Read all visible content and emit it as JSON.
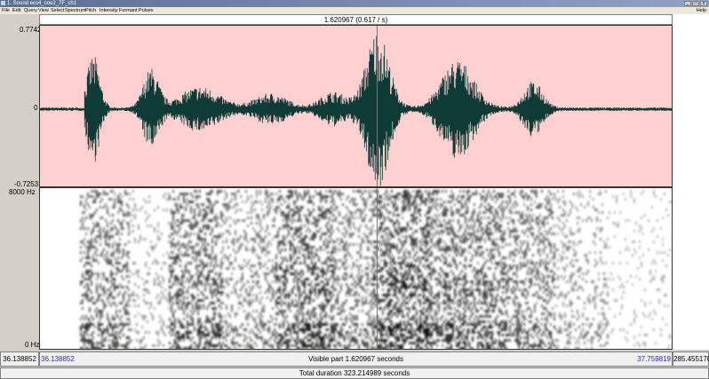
{
  "window": {
    "title": "1. Sound ecs4_coe2_7F_ch1"
  },
  "menu": {
    "items": [
      "File",
      "Edit",
      "Query",
      "View",
      "Select",
      "Spectrum",
      "Pitch",
      "Intensity",
      "Formant",
      "Pulses"
    ],
    "help": "Help"
  },
  "header": {
    "selection_label": "1.620967 (0.617 / s)"
  },
  "waveform": {
    "ymax": "0.7742",
    "zero": "0",
    "ymin": "-0.7253"
  },
  "spectrogram": {
    "fmax": "8000 Hz",
    "fmin": "0 Hz"
  },
  "footer": {
    "left_time": "36.138852",
    "window_start": "36.138852",
    "visible_part": "Visible part 1.620967 seconds",
    "window_end": "37.759819",
    "right_time": "285.455170",
    "total_duration": "Total duration 323.214989 seconds"
  },
  "colors": {
    "waveform": "#0f3b36",
    "waveform_bg": "#ffd0d0",
    "time_blue": "#2b2bd0"
  }
}
